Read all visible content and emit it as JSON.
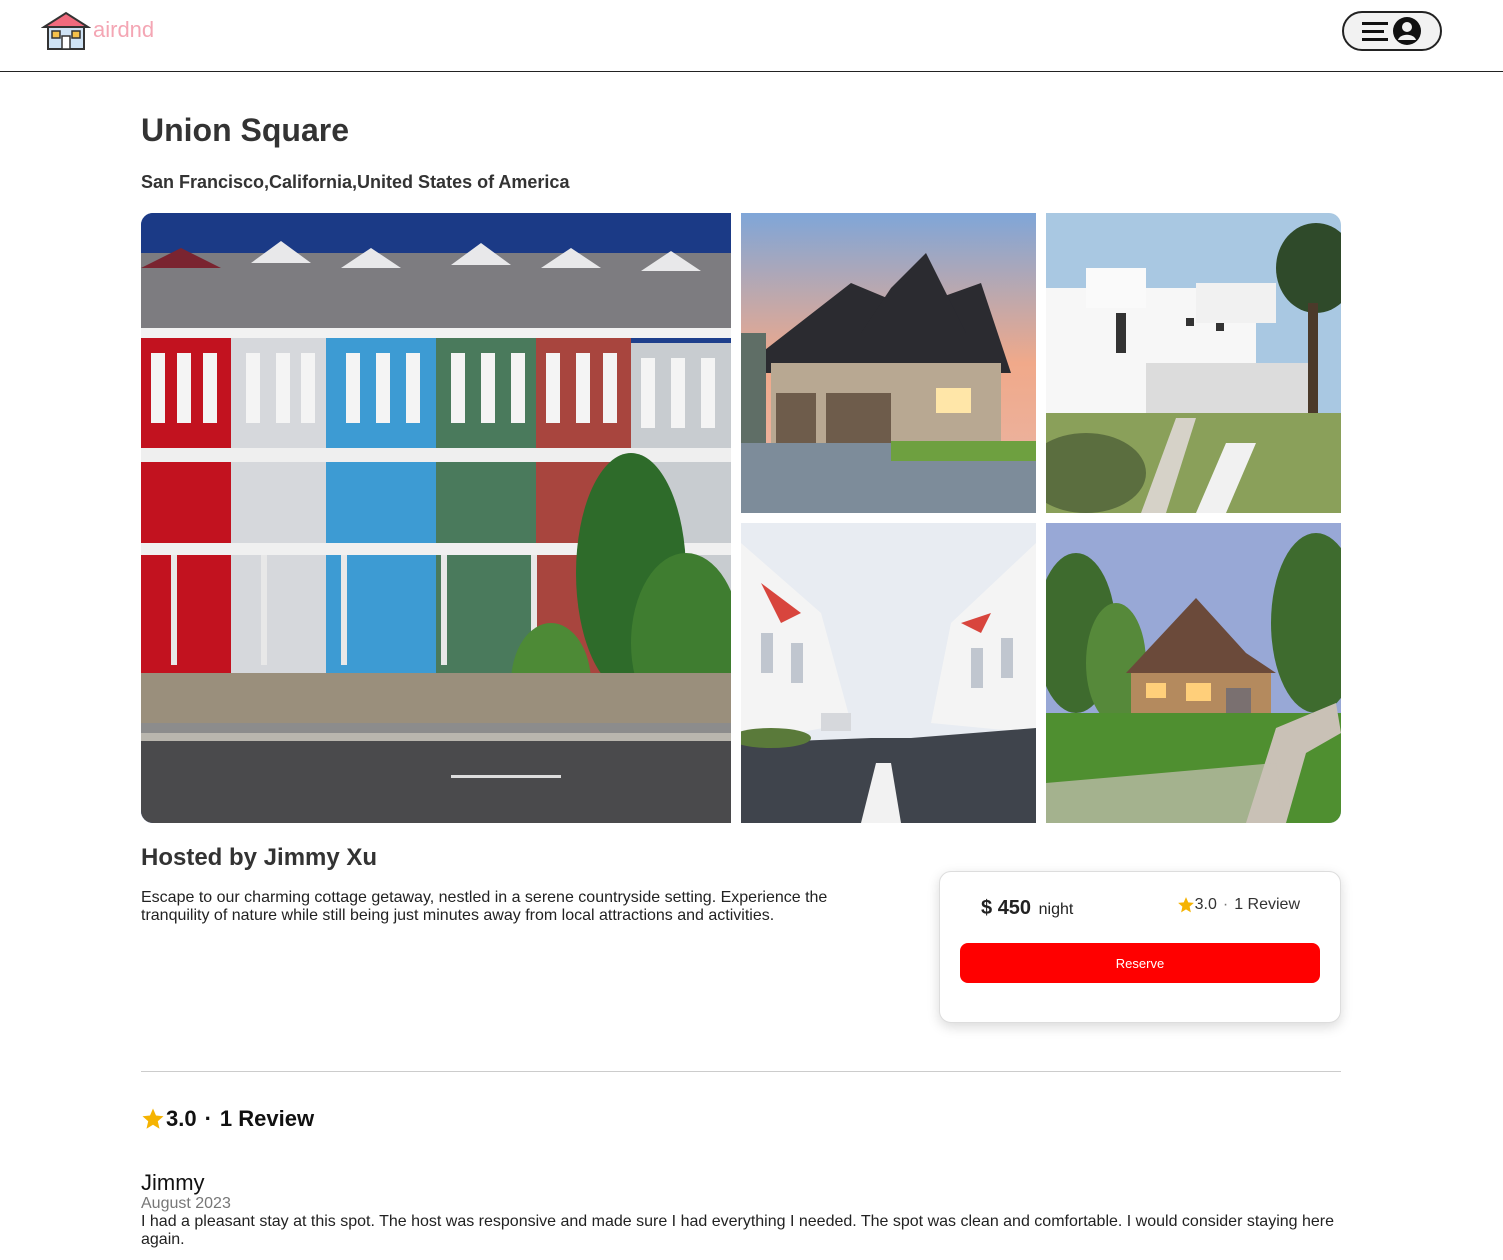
{
  "brand": {
    "name": "airdnd",
    "color": "#f4a6b4"
  },
  "header": {
    "menu_icon": "hamburger-icon",
    "user_icon": "user-circle-icon"
  },
  "spot": {
    "title": "Union Square",
    "location": "San Francisco,California,United States of America",
    "host": "Hosted by Jimmy Xu",
    "description": "Escape to our charming cottage getaway, nestled in a serene countryside setting. Experience the tranquility of nature while still being just minutes away from local attractions and activities.",
    "images": [
      {
        "alt": "colorful row houses"
      },
      {
        "alt": "suburban house at sunset"
      },
      {
        "alt": "modern white house"
      },
      {
        "alt": "street of white houses"
      },
      {
        "alt": "stone house with lawn"
      }
    ]
  },
  "booking": {
    "currency": "$",
    "price": "450",
    "unit": "night",
    "rating": "3.0",
    "separator": "·",
    "review_count": "1 Review",
    "reserve_label": "Reserve",
    "accent_color": "#ff0000",
    "star_color": "#f5b301"
  },
  "reviews": {
    "rating": "3.0",
    "separator": "·",
    "count": "1 Review",
    "items": [
      {
        "name": "Jimmy",
        "date": "August 2023",
        "text": "I had a pleasant stay at this spot. The host was responsive and made sure I had everything I needed. The spot was clean and comfortable. I would consider staying here again."
      }
    ]
  }
}
